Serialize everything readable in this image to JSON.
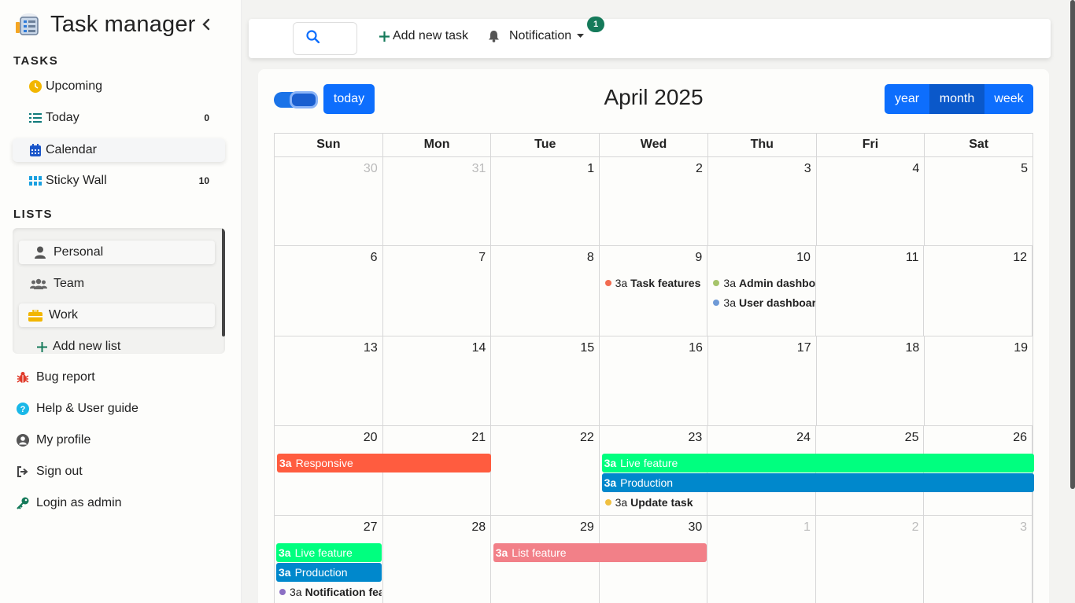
{
  "app": {
    "title": "Task manager"
  },
  "sidebar": {
    "tasks_heading": "TASKS",
    "tasks": [
      {
        "label": "Upcoming",
        "icon": "clock-icon",
        "count": ""
      },
      {
        "label": "Today",
        "icon": "list-icon",
        "count": "0"
      },
      {
        "label": "Calendar",
        "icon": "calendar-icon",
        "count": "",
        "active": true
      },
      {
        "label": "Sticky Wall",
        "icon": "grid-icon",
        "count": "10"
      }
    ],
    "lists_heading": "LISTS",
    "lists": [
      {
        "label": "Personal",
        "icon": "user-icon"
      },
      {
        "label": "Team",
        "icon": "users-icon"
      },
      {
        "label": "Work",
        "icon": "briefcase-icon"
      }
    ],
    "add_list": "Add new list",
    "bottom": [
      {
        "label": "Bug report",
        "icon": "bug-icon"
      },
      {
        "label": "Help & User guide",
        "icon": "help-icon"
      },
      {
        "label": "My profile",
        "icon": "profile-icon"
      },
      {
        "label": "Sign out",
        "icon": "signout-icon"
      },
      {
        "label": "Login as admin",
        "icon": "key-icon"
      }
    ]
  },
  "topbar": {
    "add_task": "Add new task",
    "notification": "Notification",
    "notification_count": "1"
  },
  "calendar": {
    "title": "April 2025",
    "today_label": "today",
    "views": [
      "year",
      "month",
      "week"
    ],
    "active_view": "month",
    "weekdays": [
      "Sun",
      "Mon",
      "Tue",
      "Wed",
      "Thu",
      "Fri",
      "Sat"
    ],
    "weeks": [
      {
        "days": [
          {
            "n": "30",
            "muted": true
          },
          {
            "n": "31",
            "muted": true
          },
          {
            "n": "1"
          },
          {
            "n": "2"
          },
          {
            "n": "3"
          },
          {
            "n": "4"
          },
          {
            "n": "5"
          }
        ]
      },
      {
        "days": [
          {
            "n": "6"
          },
          {
            "n": "7"
          },
          {
            "n": "8"
          },
          {
            "n": "9"
          },
          {
            "n": "10"
          },
          {
            "n": "11"
          },
          {
            "n": "12"
          }
        ]
      },
      {
        "days": [
          {
            "n": "13"
          },
          {
            "n": "14"
          },
          {
            "n": "15"
          },
          {
            "n": "16"
          },
          {
            "n": "17"
          },
          {
            "n": "18"
          },
          {
            "n": "19"
          }
        ]
      },
      {
        "days": [
          {
            "n": "20"
          },
          {
            "n": "21"
          },
          {
            "n": "22"
          },
          {
            "n": "23"
          },
          {
            "n": "24"
          },
          {
            "n": "25"
          },
          {
            "n": "26"
          }
        ]
      },
      {
        "days": [
          {
            "n": "27"
          },
          {
            "n": "28"
          },
          {
            "n": "29"
          },
          {
            "n": "30"
          },
          {
            "n": "1",
            "muted": true
          },
          {
            "n": "2",
            "muted": true
          },
          {
            "n": "3",
            "muted": true
          }
        ]
      }
    ],
    "events": [
      {
        "type": "dot",
        "week": 1,
        "start": 3,
        "slot": 0,
        "time": "3a",
        "title": "Task features",
        "color": "#f26b50"
      },
      {
        "type": "dot",
        "week": 1,
        "start": 4,
        "slot": 0,
        "time": "3a",
        "title": "Admin dashboard",
        "color": "#a6c46b"
      },
      {
        "type": "dot",
        "week": 1,
        "start": 4,
        "slot": 1,
        "time": "3a",
        "title": "User dashboard",
        "color": "#6f9ad6"
      },
      {
        "type": "bar",
        "week": 3,
        "start": 0,
        "span": 2,
        "slot": 0,
        "time": "3a",
        "title": "Responsive",
        "color": "#ff5c3f"
      },
      {
        "type": "bar",
        "week": 3,
        "start": 3,
        "span": 4,
        "slot": 0,
        "time": "3a",
        "title": "Live feature",
        "color": "#00ff7f"
      },
      {
        "type": "bar",
        "week": 3,
        "start": 3,
        "span": 4,
        "slot": 1,
        "time": "3a",
        "title": "Production",
        "color": "#0088cc"
      },
      {
        "type": "dot",
        "week": 3,
        "start": 3,
        "slot": 2,
        "time": "3a",
        "title": "Update task",
        "color": "#f0c040"
      },
      {
        "type": "bar",
        "week": 4,
        "start": 0,
        "span": 1,
        "slot": 0,
        "time": "3a",
        "title": "Live feature",
        "color": "#00ff7f"
      },
      {
        "type": "bar",
        "week": 4,
        "start": 0,
        "span": 1,
        "slot": 1,
        "time": "3a",
        "title": "Production",
        "color": "#0088cc"
      },
      {
        "type": "dot",
        "week": 4,
        "start": 0,
        "slot": 2,
        "time": "3a",
        "title": "Notification feature",
        "color": "#8b6fc4"
      },
      {
        "type": "bar",
        "week": 4,
        "start": 2,
        "span": 2,
        "slot": 0,
        "time": "3a",
        "title": "List feature",
        "color": "#f28088"
      }
    ]
  }
}
